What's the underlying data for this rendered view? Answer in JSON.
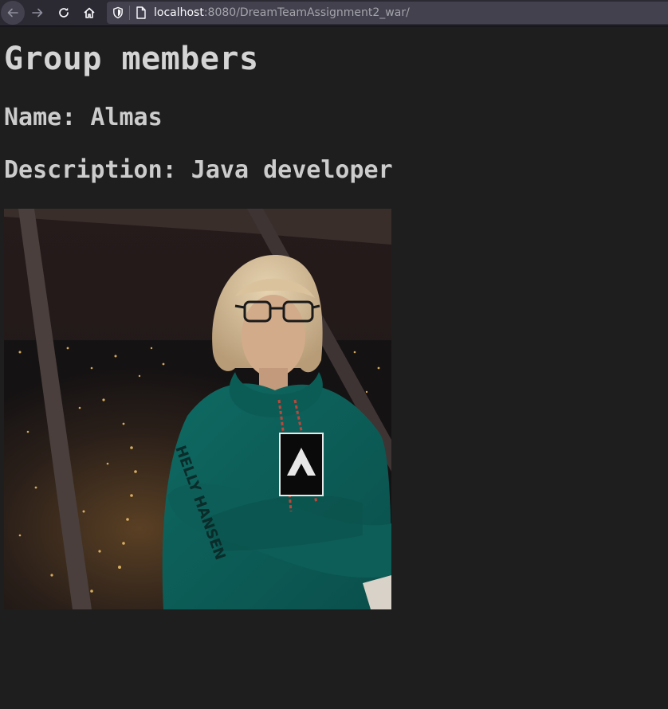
{
  "browser": {
    "url_host": "localhost",
    "url_rest": ":8080/DreamTeamAssignment2_war/",
    "icons": [
      "back-arrow-icon",
      "forward-arrow-icon",
      "reload-icon",
      "home-icon",
      "shield-icon",
      "page-icon"
    ]
  },
  "page": {
    "title": "Group members",
    "name_line": "Name: Almas",
    "description_line": "Description: Java developer"
  },
  "photo": {
    "subject": "member-photo"
  },
  "colors": {
    "page_background": "#1e1e1e",
    "text": "#cccccc",
    "browser_chrome": "#2b2a33",
    "urlbar": "#42414d"
  }
}
